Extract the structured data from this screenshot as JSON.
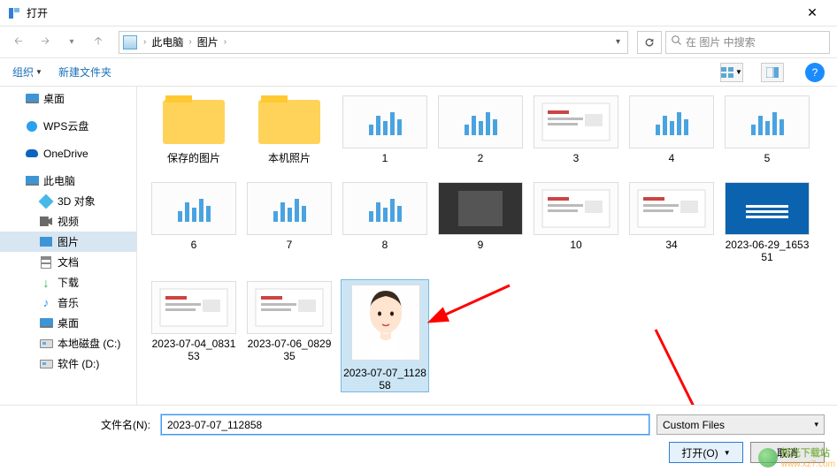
{
  "window": {
    "title": "打开"
  },
  "nav": {
    "breadcrumb": {
      "root": "此电脑",
      "folder": "图片"
    },
    "search_placeholder": "在 图片 中搜索"
  },
  "toolbar": {
    "organize": "组织",
    "new_folder": "新建文件夹",
    "help": "?"
  },
  "sidebar": {
    "items": [
      {
        "label": "桌面",
        "icon": "desktop"
      },
      {
        "label": "WPS云盘",
        "icon": "wps"
      },
      {
        "label": "OneDrive",
        "icon": "onedrive"
      },
      {
        "label": "此电脑",
        "icon": "pc"
      },
      {
        "label": "3D 对象",
        "icon": "3d",
        "indent": true
      },
      {
        "label": "视频",
        "icon": "video",
        "indent": true
      },
      {
        "label": "图片",
        "icon": "pictures",
        "indent": true,
        "selected": true
      },
      {
        "label": "文档",
        "icon": "docs",
        "indent": true
      },
      {
        "label": "下载",
        "icon": "download",
        "indent": true
      },
      {
        "label": "音乐",
        "icon": "music",
        "indent": true
      },
      {
        "label": "桌面",
        "icon": "desktop",
        "indent": true
      },
      {
        "label": "本地磁盘 (C:)",
        "icon": "disk",
        "indent": true
      },
      {
        "label": "软件 (D:)",
        "icon": "disk",
        "indent": true
      }
    ]
  },
  "files": {
    "row1": [
      {
        "label": "保存的图片",
        "type": "folder"
      },
      {
        "label": "本机照片",
        "type": "folder"
      },
      {
        "label": "1",
        "type": "bars"
      },
      {
        "label": "2",
        "type": "bars"
      },
      {
        "label": "3",
        "type": "shot"
      },
      {
        "label": "4",
        "type": "bars"
      },
      {
        "label": "5",
        "type": "bars"
      }
    ],
    "row2": [
      {
        "label": "6",
        "type": "bars"
      },
      {
        "label": "7",
        "type": "bars"
      },
      {
        "label": "8",
        "type": "bars"
      },
      {
        "label": "9",
        "type": "dark"
      },
      {
        "label": "10",
        "type": "shot"
      },
      {
        "label": "34",
        "type": "shot"
      },
      {
        "label": "2023-06-29_165351",
        "type": "blue"
      }
    ],
    "row3": [
      {
        "label": "2023-07-04_083153",
        "type": "shot"
      },
      {
        "label": "2023-07-06_082935",
        "type": "shot"
      },
      {
        "label": "2023-07-07_112858",
        "type": "face",
        "selected": true
      }
    ]
  },
  "footer": {
    "filename_label": "文件名(N):",
    "filename_value": "2023-07-07_112858",
    "filter": "Custom Files",
    "open": "打开(O)",
    "cancel": "取消"
  },
  "watermark": {
    "name": "极光下载站",
    "url": "www.xz7.com"
  }
}
